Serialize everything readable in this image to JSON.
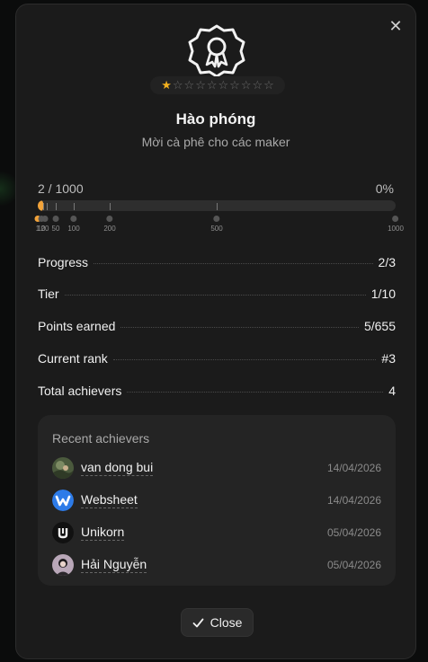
{
  "modal": {
    "close_icon": "close-icon",
    "badge_icon": "award-ribbon-icon",
    "stars": {
      "filled": 1,
      "total": 10
    },
    "title": "Hào phóng",
    "subtitle": "Mời cà phê cho các maker"
  },
  "progress": {
    "current_label": "2 / 1000",
    "percent_label": "0%",
    "value": 2,
    "max": 1000,
    "milestones": [
      "1",
      "10",
      "20",
      "50",
      "100",
      "200",
      "500",
      "1000"
    ]
  },
  "stats": [
    {
      "key": "Progress",
      "value": "2/3"
    },
    {
      "key": "Tier",
      "value": "1/10"
    },
    {
      "key": "Points earned",
      "value": "5/655"
    },
    {
      "key": "Current rank",
      "value": "#3"
    },
    {
      "key": "Total achievers",
      "value": "4"
    }
  ],
  "recent": {
    "title": "Recent achievers",
    "items": [
      {
        "name": "van dong bui",
        "date": "14/04/2026",
        "avatar": "photo"
      },
      {
        "name": "Websheet",
        "date": "14/04/2026",
        "avatar": "websheet-logo"
      },
      {
        "name": "Unikorn",
        "date": "05/04/2026",
        "avatar": "unikorn-logo"
      },
      {
        "name": "Hải Nguyễn",
        "date": "05/04/2026",
        "avatar": "photo"
      }
    ]
  },
  "footer": {
    "close_label": "Close",
    "check_icon": "check-icon"
  },
  "colors": {
    "accent": "#f2a33a",
    "star": "#f2b01e",
    "surface": "#1b1b1b"
  }
}
